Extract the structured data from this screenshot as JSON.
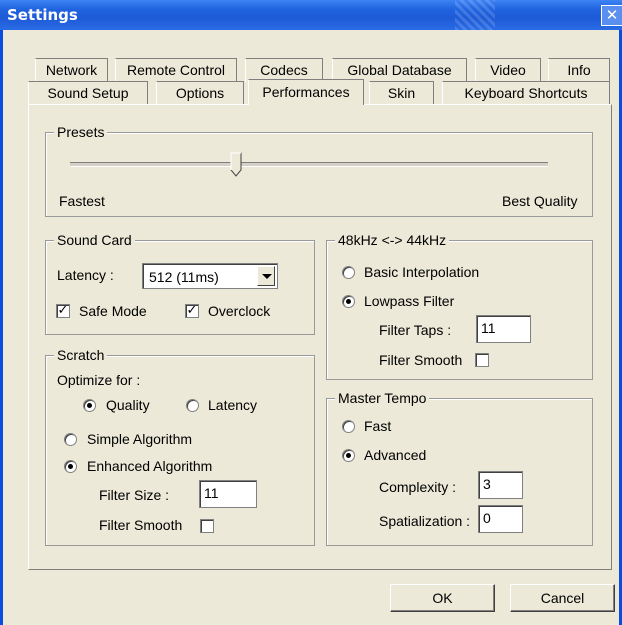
{
  "window": {
    "title": "Settings",
    "close": "✕"
  },
  "tabs_row1": [
    "Network",
    "Remote Control",
    "Codecs",
    "Global Database",
    "Video",
    "Info"
  ],
  "tabs_row2": [
    "Sound Setup",
    "Options",
    "Performances",
    "Skin",
    "Keyboard Shortcuts"
  ],
  "active_tab": "Performances",
  "presets": {
    "legend": "Presets",
    "min_label": "Fastest",
    "max_label": "Best Quality",
    "slider_value": 0.28
  },
  "sound_card": {
    "legend": "Sound Card",
    "latency_label": "Latency :",
    "latency_value": "512 (11ms)",
    "safe_mode": {
      "label": "Safe Mode",
      "checked": true
    },
    "overclock": {
      "label": "Overclock",
      "checked": true
    }
  },
  "resample": {
    "legend": "48kHz <-> 44kHz",
    "basic": {
      "label": "Basic Interpolation",
      "selected": false
    },
    "lowpass": {
      "label": "Lowpass Filter",
      "selected": true
    },
    "filter_taps_label": "Filter Taps :",
    "filter_taps_value": "11",
    "filter_smooth_label": "Filter Smooth",
    "filter_smooth_checked": false
  },
  "scratch": {
    "legend": "Scratch",
    "optimize_label": "Optimize for :",
    "quality": {
      "label": "Quality",
      "selected": true
    },
    "latency": {
      "label": "Latency",
      "selected": false
    },
    "simple": {
      "label": "Simple Algorithm",
      "selected": false
    },
    "enhanced": {
      "label": "Enhanced Algorithm",
      "selected": true
    },
    "filter_size_label": "Filter Size :",
    "filter_size_value": "11",
    "filter_smooth_label": "Filter Smooth",
    "filter_smooth_checked": false
  },
  "master_tempo": {
    "legend": "Master Tempo",
    "fast": {
      "label": "Fast",
      "selected": false
    },
    "advanced": {
      "label": "Advanced",
      "selected": true
    },
    "complexity_label": "Complexity :",
    "complexity_value": "3",
    "spatialization_label": "Spatialization :",
    "spatialization_value": "0"
  },
  "buttons": {
    "ok": "OK",
    "cancel": "Cancel"
  },
  "colors": {
    "titlebar": "#2164e0",
    "dialog_bg": "#ece9d8"
  }
}
